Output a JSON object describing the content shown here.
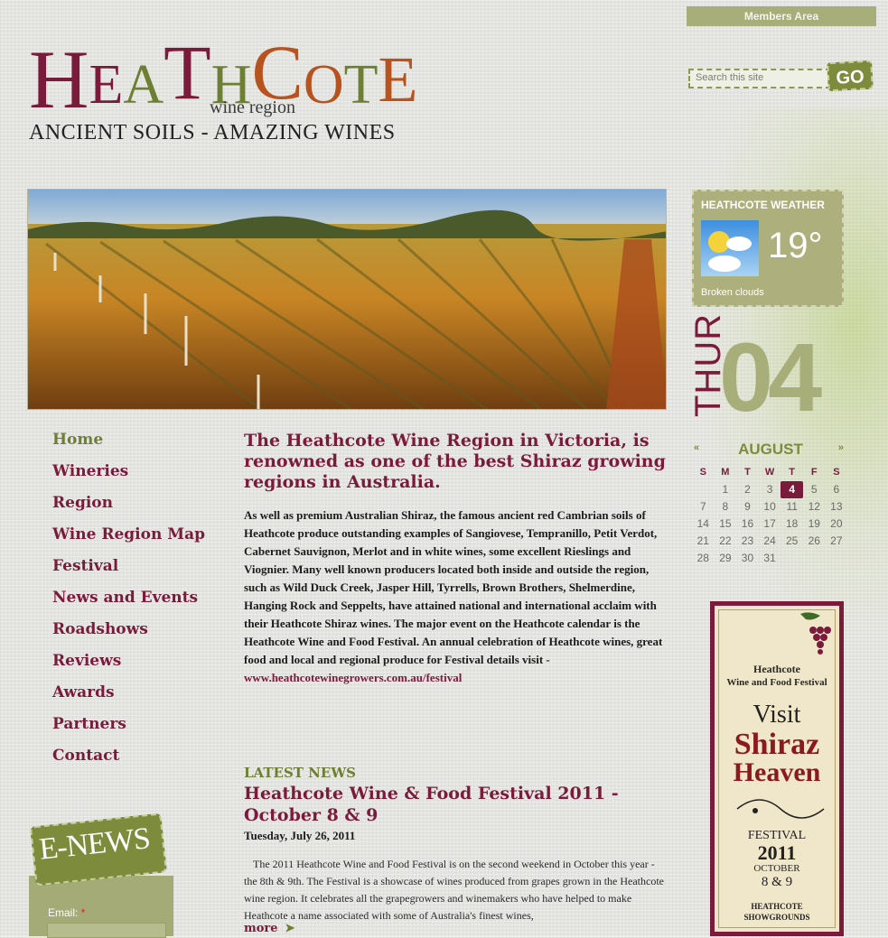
{
  "header": {
    "members_label": "Members Area",
    "logo_letters": [
      "H",
      "E",
      "A",
      "T",
      "H",
      "C",
      "O",
      "T",
      "E"
    ],
    "logo_sub": "wine region",
    "tagline": "ANCIENT SOILS - AMAZING WINES",
    "search_placeholder": "Search this site",
    "go_label": "GO"
  },
  "weather": {
    "title": "HEATHCOTE WEATHER",
    "temperature": "19°",
    "condition": "Broken clouds",
    "icon": "partly-cloudy-icon"
  },
  "date": {
    "day_of_week": "THUR",
    "day": "04"
  },
  "calendar": {
    "prev": "«",
    "next": "»",
    "month": "AUGUST",
    "day_names": [
      "S",
      "M",
      "T",
      "W",
      "T",
      "F",
      "S"
    ],
    "cells": [
      "",
      "1",
      "2",
      "3",
      "4",
      "5",
      "6",
      "7",
      "8",
      "9",
      "10",
      "11",
      "12",
      "13",
      "14",
      "15",
      "16",
      "17",
      "18",
      "19",
      "20",
      "21",
      "22",
      "23",
      "24",
      "25",
      "26",
      "27",
      "28",
      "29",
      "30",
      "31",
      "",
      "",
      ""
    ],
    "today": "4"
  },
  "nav": {
    "items": [
      {
        "label": "Home",
        "active": true
      },
      {
        "label": "Wineries"
      },
      {
        "label": "Region"
      },
      {
        "label": "Wine Region Map"
      },
      {
        "label": "Festival"
      },
      {
        "label": "News and Events"
      },
      {
        "label": "Roadshows"
      },
      {
        "label": "Reviews"
      },
      {
        "label": "Awards"
      },
      {
        "label": "Partners"
      },
      {
        "label": "Contact"
      }
    ]
  },
  "main": {
    "intro": "The Heathcote Wine Region in Victoria, is renowned as one of the best Shiraz growing regions in Australia.",
    "body": "As well as premium Australian Shiraz, the famous ancient red Cambrian soils of Heathcote produce outstanding examples of Sangiovese, Tempranillo, Petit Verdot, Cabernet Sauvignon, Merlot and in white wines, some excellent Rieslings and Viognier. Many well known producers located both inside and outside the region, such as Wild Duck Creek, Jasper Hill, Tyrrells, Brown Brothers, Shelmerdine, Hanging Rock and Seppelts, have attained national and international acclaim with their Heathcote Shiraz wines. The major event on the Heathcote calendar is the Heathcote Wine and Food Festival. An annual celebration of Heathcote wines, great food and local and regional produce  for Festival details visit -",
    "festival_link": "www.heathcotewinegrowers.com.au/festival",
    "latest_news_label": "LATEST NEWS",
    "news_title": "Heathcote Wine & Food Festival 2011 - October 8 & 9",
    "news_date": "Tuesday, July 26, 2011",
    "news_body": "The 2011 Heathcote Wine and Food Festival is on the second weekend in October this year - the 8th & 9th. The Festival is a showcase of wines produced from grapes grown in the Heathcote wine region. It celebrates all the grapegrowers and winemakers who have helped to make Heathcote a name associated with some of Australia's finest wines,",
    "more_label": "more",
    "more_arrow": "➤"
  },
  "enews": {
    "badge": "E-NEWS",
    "email_label": "Email:",
    "required_mark": "*"
  },
  "poster": {
    "line1": "Heathcote",
    "line2": "Wine and Food Festival",
    "visit": "Visit",
    "shiraz": "Shiraz",
    "heaven": "Heaven",
    "festival": "FESTIVAL",
    "year": "2011",
    "month": "OCTOBER",
    "dates": "8 & 9",
    "venue1": "HEATHCOTE",
    "venue2": "SHOWGROUNDS"
  },
  "colors": {
    "maroon": "#7a1b3c",
    "olive": "#6d7f33",
    "sage": "#a7ae7a",
    "rust": "#b7531f"
  }
}
